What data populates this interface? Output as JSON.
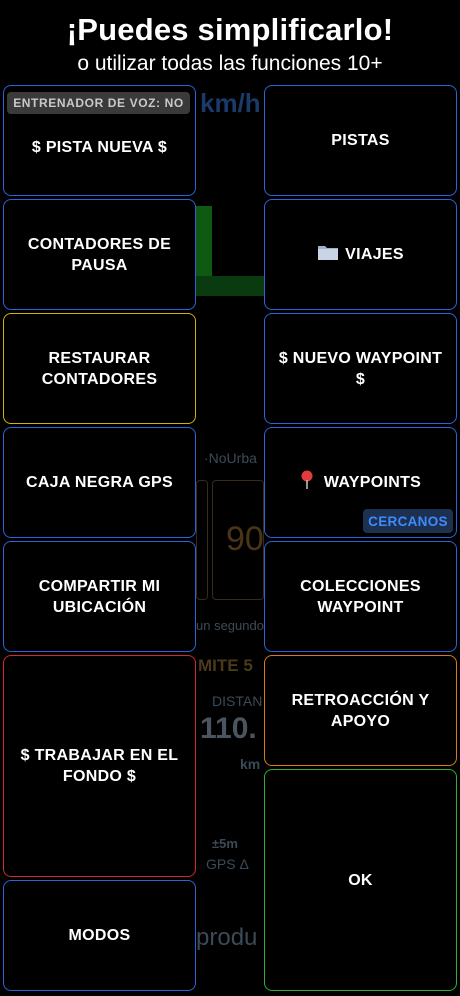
{
  "header": {
    "title": "¡Puedes simplificarlo!",
    "subtitle": "o utilizar todas las funciones 10+"
  },
  "background": {
    "speed_unit": "km/h",
    "road_type": "·NoUrba",
    "speed_value": "90",
    "seconds_text": "un segundo",
    "limit_text": "MITE 5",
    "distance_label": "DISTAN",
    "distance_value": "110.",
    "distance_unit": "km",
    "gps_accuracy": "±5m",
    "gps_label": "GPS Δ",
    "product_text": "produ"
  },
  "badges": {
    "voice_trainer": "ENTRENADOR DE VOZ: NO",
    "nearby": "CERCANOS"
  },
  "buttons": {
    "new_track": "$ PISTA NUEVA $",
    "tracks": "PISTAS",
    "pause_counters": "CONTADORES DE PAUSA",
    "trips": "VIAJES",
    "reset_counters": "RESTAURAR CONTADORES",
    "new_waypoint": "$ NUEVO WAYPOINT $",
    "gps_blackbox": "CAJA NEGRA GPS",
    "waypoints": "WAYPOINTS",
    "share_location": "COMPARTIR MI UBICACIÓN",
    "waypoint_collections": "COLECCIONES WAYPOINT",
    "work_background": "$ TRABAJAR EN EL FONDO $",
    "feedback_support": "RETROACCIÓN Y APOYO",
    "modes": "MODOS",
    "ok": "OK"
  },
  "icons": {
    "trips": "folder-icon",
    "waypoints": "pin-icon"
  },
  "colors": {
    "blue": "#2b63d9",
    "yellow": "#d1b400",
    "red": "#d22a2a",
    "orange": "#d97a12",
    "green": "#2fae32"
  }
}
